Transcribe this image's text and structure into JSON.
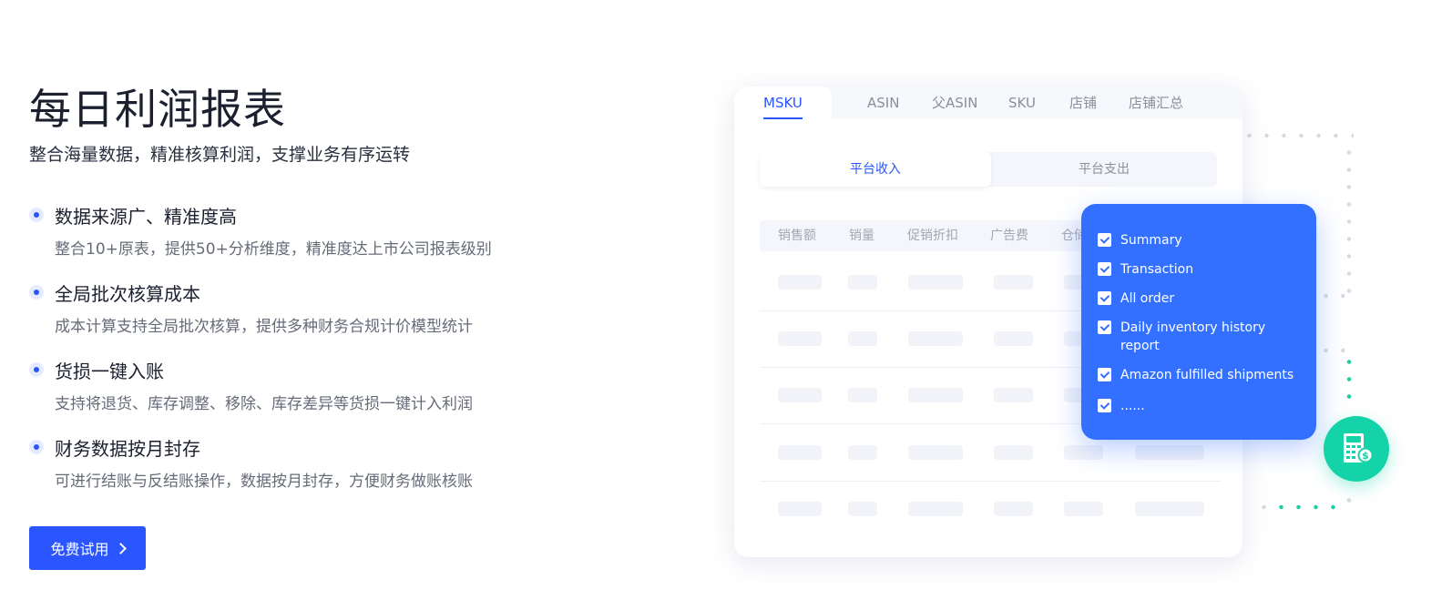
{
  "hero": {
    "title": "每日利润报表",
    "subtitle": "整合海量数据，精准核算利润，支撑业务有序运转"
  },
  "features": [
    {
      "title": "数据来源广、精准度高",
      "desc": "整合10+原表，提供50+分析维度，精准度达上市公司报表级别"
    },
    {
      "title": "全局批次核算成本",
      "desc": "成本计算支持全局批次核算，提供多种财务合规计价模型统计"
    },
    {
      "title": "货损一键入账",
      "desc": "支持将退货、库存调整、移除、库存差异等货损一键计入利润"
    },
    {
      "title": "财务数据按月封存",
      "desc": "可进行结账与反结账操作，数据按月封存，方便财务做账核账"
    }
  ],
  "cta": {
    "label": "免费试用"
  },
  "card": {
    "tabs": [
      "MSKU",
      "ASIN",
      "父ASIN",
      "SKU",
      "店铺",
      "店铺汇总"
    ],
    "active_tab": "MSKU",
    "segments": [
      "平台收入",
      "平台支出"
    ],
    "columns": [
      "销售额",
      "销量",
      "促销折扣",
      "广告费",
      "仓储"
    ]
  },
  "popup": {
    "options": [
      "Summary",
      "Transaction",
      "All order",
      "Daily inventory history report",
      "Amazon fulfilled shipments",
      "......"
    ]
  },
  "colors": {
    "primary": "#2a55ff",
    "popup_blue": "#3370ff",
    "green": "#14d3a8"
  },
  "icons": {
    "bullet": "dot-icon",
    "cta_arrow": "chevron-right-icon",
    "checkbox": "checkbox-checked-icon",
    "badge": "calculator-dollar-icon"
  }
}
